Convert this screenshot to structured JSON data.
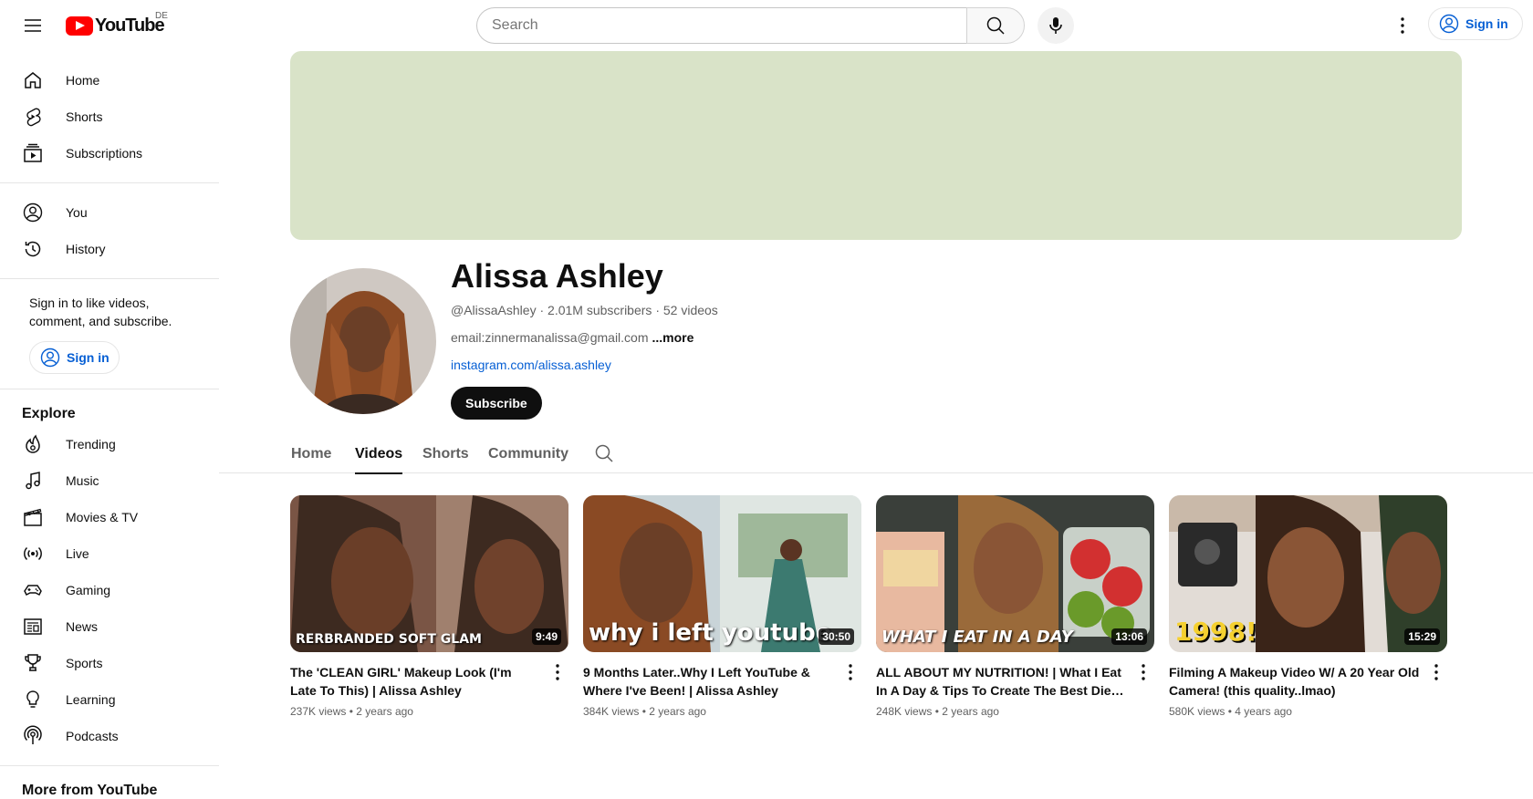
{
  "header": {
    "logo_text": "YouTube",
    "country_code": "DE",
    "search_placeholder": "Search",
    "sign_in_label": "Sign in"
  },
  "sidebar": {
    "primary": [
      {
        "label": "Home",
        "icon": "home-icon"
      },
      {
        "label": "Shorts",
        "icon": "shorts-icon"
      },
      {
        "label": "Subscriptions",
        "icon": "subscriptions-icon"
      }
    ],
    "secondary": [
      {
        "label": "You",
        "icon": "you-icon"
      },
      {
        "label": "History",
        "icon": "history-icon"
      }
    ],
    "signin_prompt": "Sign in to like videos, comment, and subscribe.",
    "signin_label": "Sign in",
    "explore_title": "Explore",
    "explore": [
      {
        "label": "Trending",
        "icon": "trending-icon"
      },
      {
        "label": "Music",
        "icon": "music-icon"
      },
      {
        "label": "Movies & TV",
        "icon": "movies-icon"
      },
      {
        "label": "Live",
        "icon": "live-icon"
      },
      {
        "label": "Gaming",
        "icon": "gaming-icon"
      },
      {
        "label": "News",
        "icon": "news-icon"
      },
      {
        "label": "Sports",
        "icon": "sports-icon"
      },
      {
        "label": "Learning",
        "icon": "learning-icon"
      },
      {
        "label": "Podcasts",
        "icon": "podcasts-icon"
      }
    ],
    "more_title": "More from YouTube"
  },
  "channel": {
    "name": "Alissa Ashley",
    "handle": "@AlissaAshley",
    "subscribers": "2.01M subscribers",
    "videos_count": "52 videos",
    "description": "email:zinnermanalissa@gmail.com",
    "more_label": "...more",
    "link": "instagram.com/alissa.ashley",
    "subscribe_label": "Subscribe",
    "banner_color": "#d9e3c8"
  },
  "tabs": [
    {
      "label": "Home",
      "active": false
    },
    {
      "label": "Videos",
      "active": true
    },
    {
      "label": "Shorts",
      "active": false
    },
    {
      "label": "Community",
      "active": false
    }
  ],
  "videos": [
    {
      "title": "The 'CLEAN GIRL' Makeup Look (I'm Late To This) | Alissa Ashley",
      "views": "237K views",
      "age": "2 years ago",
      "duration": "9:49",
      "thumb_text": "RERBRANDED SOFT GLAM"
    },
    {
      "title": "9 Months Later..Why I Left YouTube & Where I've Been! | Alissa Ashley",
      "views": "384K views",
      "age": "2 years ago",
      "duration": "30:50",
      "thumb_text": "why i left youtube"
    },
    {
      "title": "ALL ABOUT MY NUTRITION! | What I Eat In A Day & Tips To Create The Best Diet For YOU...",
      "views": "248K views",
      "age": "2 years ago",
      "duration": "13:06",
      "thumb_text": "WHAT I EAT IN A DAY"
    },
    {
      "title": "Filming A Makeup Video W/ A 20 Year Old Camera! (this quality..lmao)",
      "views": "580K views",
      "age": "4 years ago",
      "duration": "15:29",
      "thumb_text": "1998!"
    }
  ]
}
